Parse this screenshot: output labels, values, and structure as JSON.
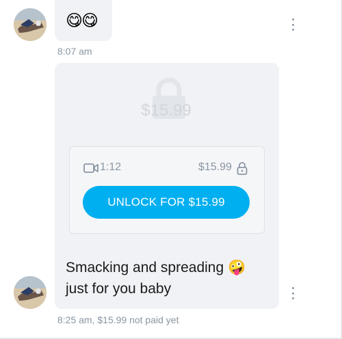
{
  "messages": [
    {
      "emoji": "😋😋",
      "timestamp": "8:07 am",
      "avatar_name": "avatar"
    },
    {
      "locked_preview_price": "$15.99",
      "media": {
        "icon": "video-camera-icon",
        "duration": "1:12",
        "price": "$15.99",
        "lock_icon": "lock-icon"
      },
      "unlock_button_label": "UNLOCK FOR $15.99",
      "caption_line1": "Smacking and spreading 🤪",
      "caption_line2": "just for you baby",
      "timestamp": "8:25 am,",
      "payment_status": "$15.99 not paid yet"
    }
  ],
  "colors": {
    "accent": "#00aff0",
    "bubble_bg": "#f1f2f5",
    "muted_text": "#8a96a3",
    "placeholder_text": "#d2d6dc"
  }
}
